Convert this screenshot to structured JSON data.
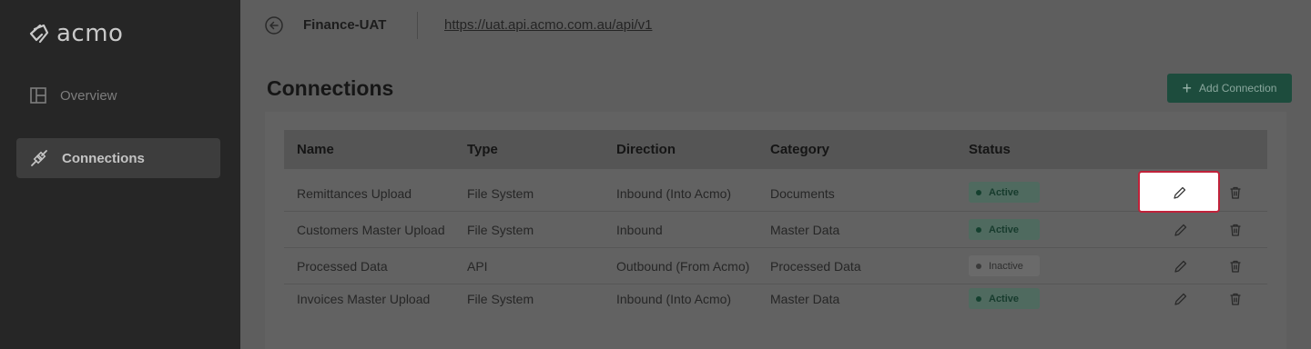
{
  "app": {
    "logo_text": "acmo"
  },
  "sidebar": {
    "items": [
      {
        "label": "Overview",
        "icon": "layout-icon",
        "active": false
      },
      {
        "label": "Connections",
        "icon": "connection-plug-icon",
        "active": true
      }
    ]
  },
  "header": {
    "environment": "Finance-UAT",
    "url": "https://uat.api.acmo.com.au/api/v1"
  },
  "main": {
    "title": "Connections",
    "add_button_label": "Add Connection"
  },
  "table": {
    "columns": [
      "Name",
      "Type",
      "Direction",
      "Category",
      "Status"
    ],
    "rows": [
      {
        "name": "Remittances Upload",
        "type": "File System",
        "direction": "Inbound (Into Acmo)",
        "category": "Documents",
        "status": "Active"
      },
      {
        "name": "Customers Master Upload",
        "type": "File System",
        "direction": "Inbound",
        "category": "Master Data",
        "status": "Active"
      },
      {
        "name": "Processed Data",
        "type": "API",
        "direction": "Outbound (From Acmo)",
        "category": "Processed Data",
        "status": "Inactive"
      },
      {
        "name": "Invoices Master Upload",
        "type": "File System",
        "direction": "Inbound (Into Acmo)",
        "category": "Master Data",
        "status": "Active"
      }
    ]
  },
  "colors": {
    "accent": "#1d4c3d",
    "highlight_border": "#c0223a",
    "active_badge": "#4f6a5f"
  }
}
